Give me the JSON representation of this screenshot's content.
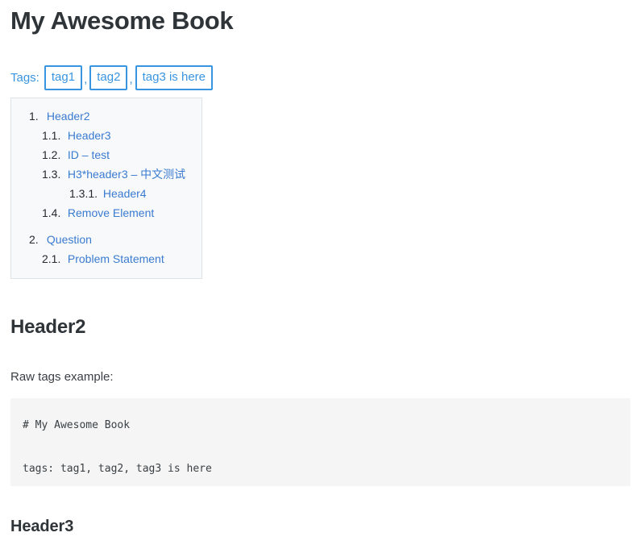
{
  "document": {
    "title": "My Awesome Book"
  },
  "tags": {
    "label": "Tags:",
    "separator": ",",
    "items": [
      {
        "name": "tag1"
      },
      {
        "name": "tag2"
      },
      {
        "name": "tag3 is here"
      }
    ]
  },
  "toc": {
    "entries": [
      {
        "number": "1.",
        "label": "Header2",
        "level": 1
      },
      {
        "number": "1.1.",
        "label": "Header3",
        "level": 2
      },
      {
        "number": "1.2.",
        "label": "ID – test",
        "level": 2
      },
      {
        "number": "1.3.",
        "label": "H3*header3 – 中文测试",
        "level": 2
      },
      {
        "number": "1.3.1.",
        "label": "Header4",
        "level": 3
      },
      {
        "number": "1.4.",
        "label": "Remove Element",
        "level": 2
      },
      {
        "number": "2.",
        "label": "Question",
        "level": 1
      },
      {
        "number": "2.1.",
        "label": "Problem Statement",
        "level": 2
      }
    ]
  },
  "content": {
    "heading_header2": "Header2",
    "paragraph_raw_tags": "Raw tags example:",
    "code_block": "# My Awesome Book\n\ntags: tag1, tag2, tag3 is here",
    "heading_header3": "Header3"
  },
  "colors": {
    "link_blue": "#3a7bd0",
    "tag_blue": "#3a95e0",
    "heading": "#2f3438",
    "body_text": "#3b4045",
    "toc_background": "#f8f9fb",
    "toc_border": "#dfe2e5",
    "code_background": "#f5f5f5"
  }
}
